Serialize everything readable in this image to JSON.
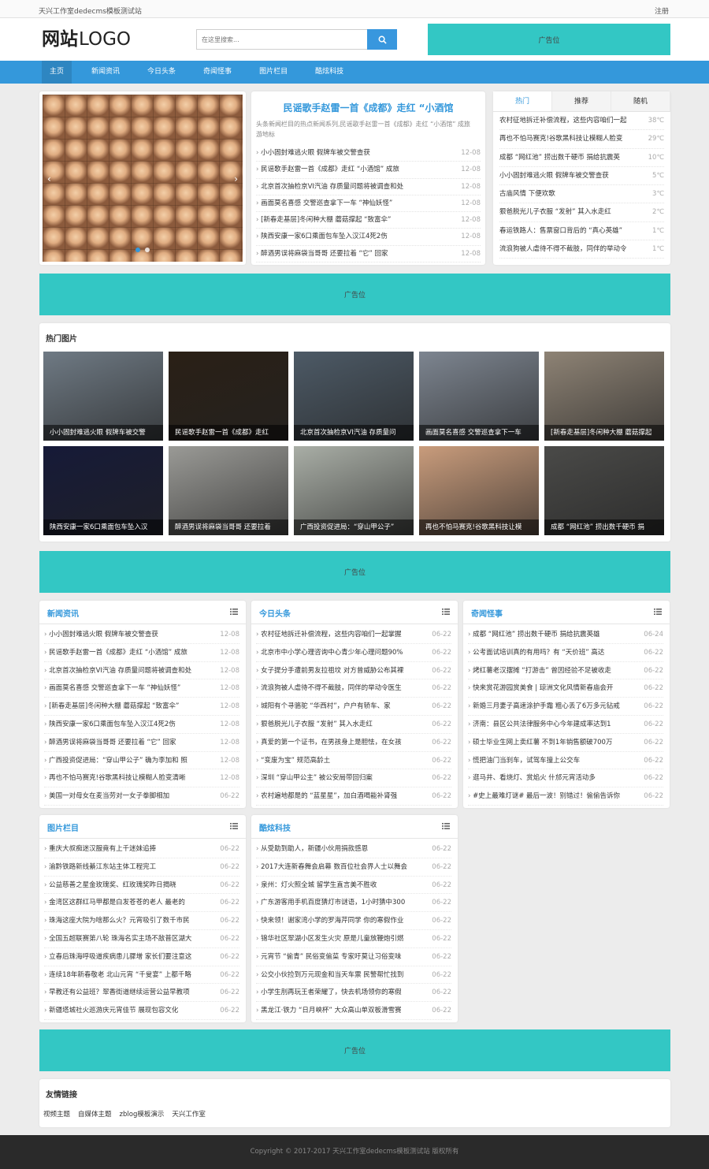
{
  "topbar": {
    "site": "天兴工作室dedecms模板测试站",
    "register": "注册"
  },
  "header": {
    "logo_bold": "网站",
    "logo_rest": "LOGO",
    "search_placeholder": "在这里搜索...",
    "ad": "广告位"
  },
  "nav": [
    "主页",
    "新闻资讯",
    "今日头条",
    "奇闻怪事",
    "图片栏目",
    "酷炫科技"
  ],
  "headline": {
    "title": "民谣歌手赵雷一首《成都》走红 “小酒馆",
    "desc": "头条新闻栏目的热点新闻系列,民谣歌手赵雷一首《成都》走红 “小酒馆” 成旅游地标",
    "items": [
      {
        "t": "小小固封难逃火眼 假牌车被交警查获",
        "d": "12-08"
      },
      {
        "t": "民谣歌手赵雷一首《成都》走红 “小酒馆” 成旅",
        "d": "12-08"
      },
      {
        "t": "北京首次抽检京VI汽油 存质量问题将被调查和处",
        "d": "12-08"
      },
      {
        "t": "画面莫名喜感 交警巡查拿下一车 “神仙妖怪”",
        "d": "12-08"
      },
      {
        "t": "[新春走基层]冬闲种大棚 蘑菇撑起 “致富伞”",
        "d": "12-08"
      },
      {
        "t": "陕西安康一家6口乘面包车坠入汉江4死2伤",
        "d": "12-08"
      },
      {
        "t": "醉酒男误将麻袋当哥哥 还要拉着 “它” 回家",
        "d": "12-08"
      }
    ]
  },
  "tabs": {
    "labels": [
      "热门",
      "推荐",
      "随机"
    ],
    "items": [
      {
        "t": "农村征地拆迁补偿流程，这些内容咱们一起",
        "v": "38℃"
      },
      {
        "t": "再也不怕马赛克!谷歌黑科技让模糊人脸变",
        "v": "29℃"
      },
      {
        "t": "成都 “网红池” 捞出数千硬币 捐给抗震英",
        "v": "10℃"
      },
      {
        "t": "小小固封难逃火眼 假牌车被交警查获",
        "v": "5℃"
      },
      {
        "t": "古庙风情 下便欢歌",
        "v": "3℃"
      },
      {
        "t": "狠爸脱光儿子衣服 “发射” 其入水走红",
        "v": "2℃"
      },
      {
        "t": "春运铁路人：售票窗口背后的 “真心英雄”",
        "v": "1℃"
      },
      {
        "t": "流浪狗被人虐待不得不截肢，同伴的举动令",
        "v": "1℃"
      }
    ]
  },
  "ads": {
    "a1": "广告位",
    "a2": "广告位",
    "a3": "广告位"
  },
  "hotpics": {
    "title": "热门图片",
    "items": [
      {
        "cap": "小小固封难逃火眼 假牌车被交警",
        "bg": "#6f7a84"
      },
      {
        "cap": "民谣歌手赵雷一首《成都》走红",
        "bg": "#2a2016"
      },
      {
        "cap": "北京首次抽检京VI汽油 存质量问",
        "bg": "#4d5a66"
      },
      {
        "cap": "画面莫名喜感 交警巡查拿下一车",
        "bg": "#7d8590"
      },
      {
        "cap": "[新春走基层]冬闲种大棚 蘑菇撑起",
        "bg": "#8e8375"
      },
      {
        "cap": "陕西安康一家6口乘面包车坠入汉",
        "bg": "#161a38"
      },
      {
        "cap": "醉酒男误将麻袋当哥哥 还要拉着",
        "bg": "#9a9a96"
      },
      {
        "cap": "广西投资促进局：“穿山甲公子”",
        "bg": "#a9aea6"
      },
      {
        "cap": "再也不怕马赛克!谷歌黑科技让模",
        "bg": "#c99c7c"
      },
      {
        "cap": "成都 “网红池” 捞出数千硬币 捐",
        "bg": "#4a4a48"
      }
    ]
  },
  "boxes": [
    {
      "title": "新闻资讯",
      "items": [
        {
          "t": "小小固封难逃火眼 假牌车被交警查获",
          "d": "12-08"
        },
        {
          "t": "民谣歌手赵雷一首《成都》走红 “小酒馆” 成旅",
          "d": "12-08"
        },
        {
          "t": "北京首次抽检京VI汽油 存质量问题将被调查和处",
          "d": "12-08"
        },
        {
          "t": "画面莫名喜感 交警巡查拿下一车 “神仙妖怪”",
          "d": "12-08"
        },
        {
          "t": "[新春走基层]冬闲种大棚 蘑菇撑起 “致富伞”",
          "d": "12-08"
        },
        {
          "t": "陕西安康一家6口乘面包车坠入汉江4死2伤",
          "d": "12-08"
        },
        {
          "t": "醉酒男误将麻袋当哥哥 还要拉着 “它” 回家",
          "d": "12-08"
        },
        {
          "t": "广西投资促进局：“穿山甲公子” 确为李加和 照",
          "d": "12-08"
        },
        {
          "t": "再也不怕马赛克!谷歌黑科技让模糊人脸变清晰",
          "d": "12-08"
        },
        {
          "t": "美国一对母女在麦当劳对一女子拳脚相加",
          "d": "06-22"
        }
      ]
    },
    {
      "title": "今日头条",
      "items": [
        {
          "t": "农村征地拆迁补偿流程，这些内容咱们一起掌握",
          "d": "06-22"
        },
        {
          "t": "北京市中小学心理咨询中心青少年心理问题90%",
          "d": "06-22"
        },
        {
          "t": "女子提分手遭前男友拉祖坟 对方曾威胁公布其裸",
          "d": "06-22"
        },
        {
          "t": "流浪狗被人虐待不得不截肢，同伴的举动令医生",
          "d": "06-22"
        },
        {
          "t": "城阳有个寻骆驼 “华西村”，户户有轿车、家",
          "d": "06-22"
        },
        {
          "t": "狠爸脱光儿子衣服 “发射” 其入水走红",
          "d": "06-22"
        },
        {
          "t": "真爱的第一个证书，在男孩身上是胆怯，在女孩",
          "d": "06-22"
        },
        {
          "t": "“变废为宝” 规范高龄土",
          "d": "06-22"
        },
        {
          "t": "深圳 “穿山甲公主” 被公安局带回归案",
          "d": "06-22"
        },
        {
          "t": "农村遍地都是的 “蓝星星”，加白酒喝能补肾强",
          "d": "06-22"
        }
      ]
    },
    {
      "title": "奇闻怪事",
      "items": [
        {
          "t": "成都 “网红池” 捞出数千硬币 捐给抗震英雄",
          "d": "06-24"
        },
        {
          "t": "公考面试培训真的有用吗？有 “天价班” 高达",
          "d": "06-22"
        },
        {
          "t": "烤红薯老汉摆摊 “打游击” 曾因经验不足被收走",
          "d": "06-22"
        },
        {
          "t": "快来赏花游园赏美食 | 琼洲文化风情新春庙会开",
          "d": "06-22"
        },
        {
          "t": "新婚三月妻子高速涂护手霜 粗心丢了6万多元钻戒",
          "d": "06-22"
        },
        {
          "t": "济南：县区公共法律服务中心今年建成率达到1",
          "d": "06-22"
        },
        {
          "t": "硕士毕业生网上卖红薯 不到1年销售额破700万",
          "d": "06-22"
        },
        {
          "t": "慌把油门当刹车，试驾车撞上公交车",
          "d": "06-22"
        },
        {
          "t": "逛马井、看烧灯、赏焰火 什邡元宵活动多",
          "d": "06-22"
        },
        {
          "t": "#史上最难灯谜# 最后一波！别错过！偷偷告诉你",
          "d": "06-22"
        }
      ]
    },
    {
      "title": "图片栏目",
      "items": [
        {
          "t": "重庆大叔痴迷汉服竟有上千迷妹追捧",
          "d": "06-22"
        },
        {
          "t": "渝黔铁路新线綦江东站主体工程完工",
          "d": "06-22"
        },
        {
          "t": "公益慈善之星金玫瑰奖、红玫瑰奖昨日揭晓",
          "d": "06-22"
        },
        {
          "t": "金湾区这群红马甲都是白发苍苍的老人 最老的",
          "d": "06-22"
        },
        {
          "t": "珠海这座大院为啥那么火？元宵吸引了数千市民",
          "d": "06-22"
        },
        {
          "t": "全国五超联赛第八轮 珠海名实主场不敌普区湖大",
          "d": "06-22"
        },
        {
          "t": "立春后珠海呼吸道疾病患儿骤增 家长们要注意这",
          "d": "06-22"
        },
        {
          "t": "连续18年新春敬老 北山元宵 “千叟宴” 上都千略",
          "d": "06-22"
        },
        {
          "t": "早教还有公益班？翠香街道继续运营公益早教项",
          "d": "06-22"
        },
        {
          "t": "新疆塔城社火巡游庆元宵佳节 展现包容文化",
          "d": "06-22"
        }
      ]
    },
    {
      "title": "酷炫科技",
      "items": [
        {
          "t": "从受助到助人，新疆小伙用捐款感恩",
          "d": "06-22"
        },
        {
          "t": "2017大连新春舞会启幕 数百位社会界人士以舞会",
          "d": "06-22"
        },
        {
          "t": "泉州：灯火照全城 留学生直言美不胜收",
          "d": "06-22"
        },
        {
          "t": "广东游客用手机百度猜灯市谜语，1小时猜中300",
          "d": "06-22"
        },
        {
          "t": "快来领！谢家湾小学的罗海芹同学 你的寒假作业",
          "d": "06-22"
        },
        {
          "t": "锦华社区翠湖小区发生火灾 原是儿童放鞭炮引燃",
          "d": "06-22"
        },
        {
          "t": "元宵节 “偷青” 民俗变偷菜 专家吁莫让习俗变味",
          "d": "06-22"
        },
        {
          "t": "公交小伙捡到万元现金和当天车票 民警帮忙找到",
          "d": "06-22"
        },
        {
          "t": "小学生刖再玩王者荣耀了，快去机场领你的寒假",
          "d": "06-22"
        },
        {
          "t": "黑龙江·铁力 “日月峡杯” 大众高山单双板滑雪赛",
          "d": "06-22"
        }
      ]
    }
  ],
  "links": {
    "title": "友情链接",
    "items": [
      "视频主题",
      "自媒体主题",
      "zblog模板演示",
      "天兴工作室"
    ]
  },
  "footer": "Copyright © 2017-2017 天兴工作室dedecms模板测试站 版权所有"
}
